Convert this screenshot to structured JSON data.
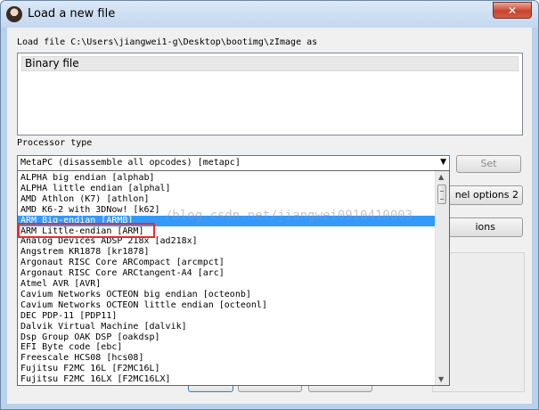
{
  "window": {
    "title": "Load a new file",
    "close_label": "✕"
  },
  "dialog": {
    "load_file_label": "Load file C:\\Users\\jiangwei1-g\\Desktop\\bootimg\\zImage as",
    "file_types": [
      "Binary file"
    ],
    "processor_type_label": "Processor type",
    "processor_selected": "MetaPC (disassemble all opcodes) [metapc]",
    "set_button": "Set",
    "kernel_options_button": "nel options 2",
    "options_button": "ions"
  },
  "dropdown": {
    "selected_index": 4,
    "items": [
      "ALPHA big endian [alphab]",
      "ALPHA little endian [alphal]",
      "AMD Athlon (K7) [athlon]",
      "AMD K6-2 with 3DNow! [k62]",
      "ARM Big-endian [ARMB]",
      "ARM Little-endian [ARM]",
      "Analog Devices ADSP 218x [ad218x]",
      "Angstrem KR1878 [kr1878]",
      "Argonaut RISC Core ARCompact [arcmpct]",
      "Argonaut RISC Core ARCtangent-A4 [arc]",
      "Atmel AVR [AVR]",
      "Cavium Networks OCTEON big endian [octeonb]",
      "Cavium Networks OCTEON little endian [octeonl]",
      "DEC PDP-11 [PDP11]",
      "Dalvik Virtual Machine [dalvik]",
      "Dsp Group OAK DSP [oakdsp]",
      "EFI Byte code [ebc]",
      "Freescale HCS08 [hcs08]",
      "Fujitsu F2MC 16L [F2MC16L]",
      "Fujitsu F2MC 16LX [F2MC16LX]"
    ]
  },
  "watermark": "/blog.csdn.net/jiangwei0910410003",
  "icons": {
    "combo_arrow": "▼",
    "scroll_up": "▲",
    "scroll_down": "▼"
  },
  "colors": {
    "selection": "#3399ff",
    "highlight_box": "#e0302a",
    "close_button": "#c7452e"
  }
}
